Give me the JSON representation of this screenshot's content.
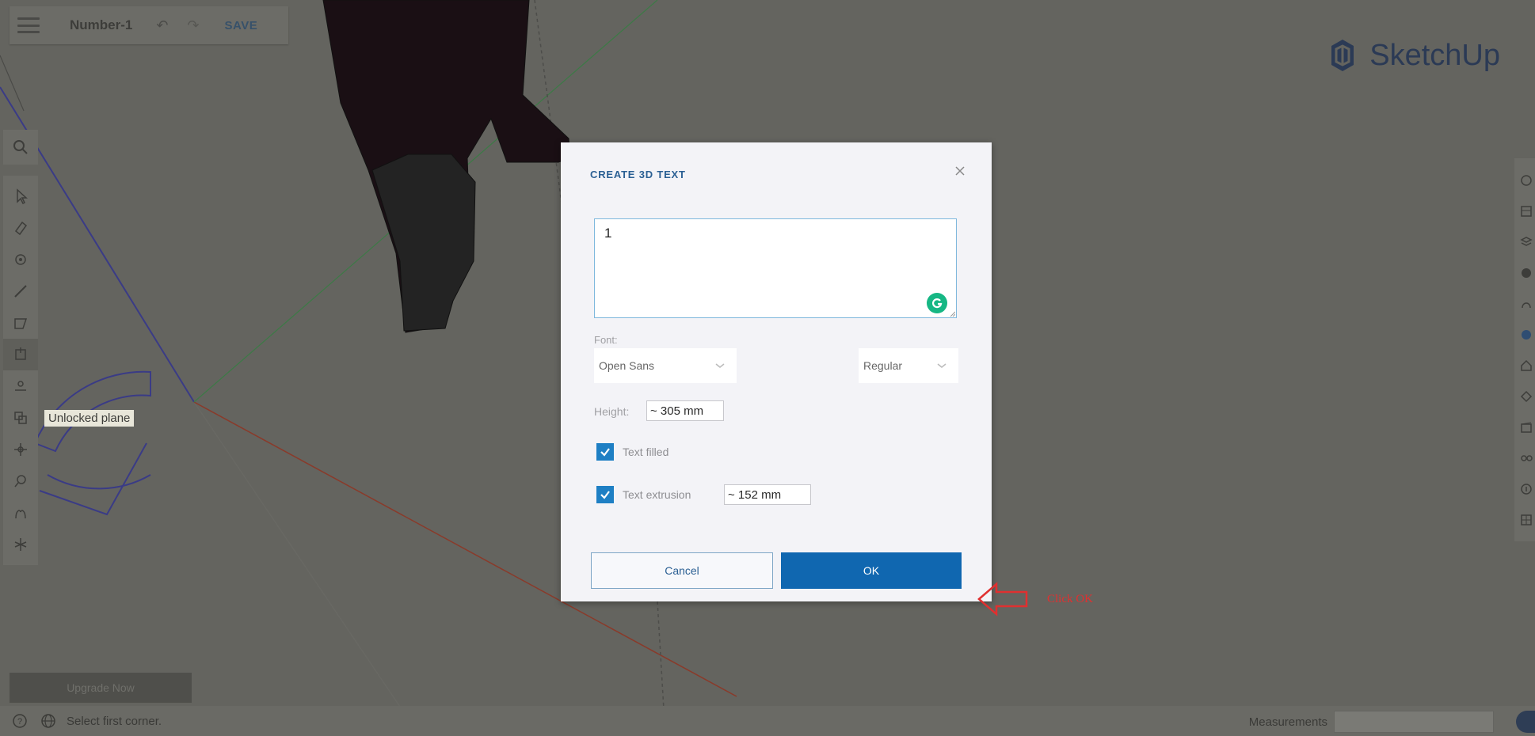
{
  "app": {
    "document_title": "Number-1",
    "save_label": "SAVE",
    "brand": "SketchUp",
    "brand_color": "#2b3a55"
  },
  "left_toolbar": {
    "search_icon": "search-icon",
    "tools": [
      "select-icon",
      "eraser-icon",
      "paint-bucket-icon",
      "pencil-icon",
      "shape-icon",
      "push-pull-icon",
      "move-icon",
      "offset-icon",
      "tape-measure-icon",
      "orbit-icon",
      "walk-icon",
      "section-icon"
    ]
  },
  "right_panel": {
    "icons": [
      "entity-info-icon",
      "instructor-icon",
      "components-icon",
      "materials-icon",
      "styles-icon",
      "layers-icon",
      "scenes-icon",
      "shadows-icon",
      "outliner-icon",
      "display-icon",
      "info-icon",
      "solar-icon"
    ]
  },
  "viewport": {
    "tooltip": "Unlocked plane"
  },
  "dialog": {
    "title": "CREATE 3D TEXT",
    "text_value": "1",
    "font_label": "Font:",
    "font_value": "Open Sans",
    "style_value": "Regular",
    "height_label": "Height:",
    "height_value": "~ 305 mm",
    "text_filled_label": "Text filled",
    "text_filled_checked": true,
    "text_extrusion_label": "Text extrusion",
    "text_extrusion_checked": true,
    "extrusion_value": "~ 152 mm",
    "cancel_label": "Cancel",
    "ok_label": "OK",
    "accent_color": "#1067b0"
  },
  "annotation": {
    "text": "Click OK",
    "color": "#e03030"
  },
  "bottom": {
    "upgrade_label": "Upgrade Now",
    "status_text": "Select first corner.",
    "measurements_label": "Measurements",
    "measurements_value": ""
  }
}
